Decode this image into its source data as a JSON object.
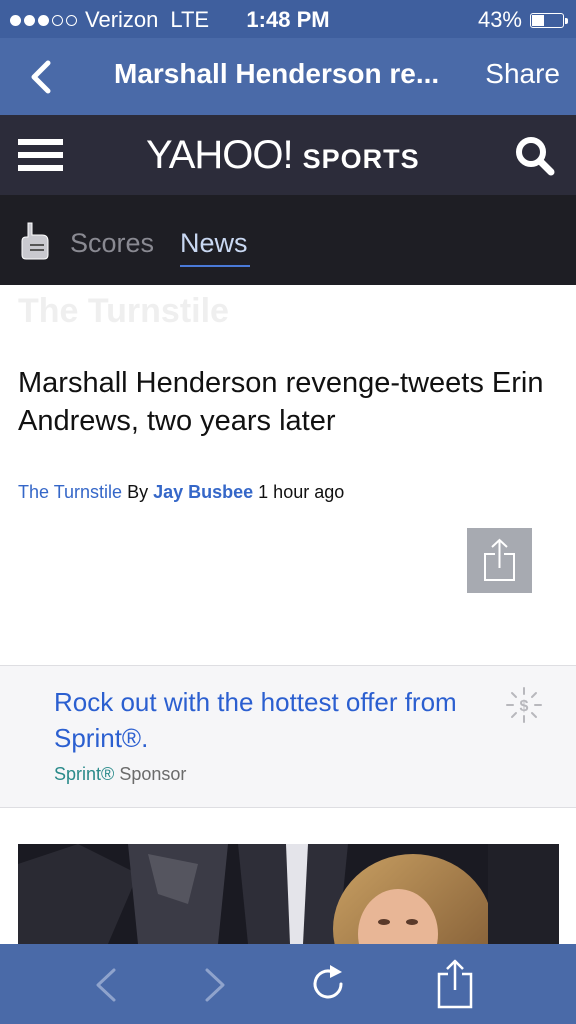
{
  "status_bar": {
    "carrier": "Verizon",
    "network": "LTE",
    "time": "1:48 PM",
    "battery": "43%",
    "signal_bars_filled": 3,
    "signal_bars_total": 5,
    "battery_level": 0.43
  },
  "nav_bar": {
    "title": "Marshall Henderson re...",
    "share_label": "Share"
  },
  "yahoo_header": {
    "logo_text": "YAHOO!",
    "sports_text": "SPORTS"
  },
  "tabs": {
    "scores": "Scores",
    "news": "News",
    "active": "News"
  },
  "article": {
    "section": "The Turnstile",
    "headline": "Marshall Henderson revenge-tweets Erin Andrews, two years later",
    "source": "The Turnstile",
    "by": "By",
    "author": "Jay Busbee",
    "time_ago": "1 hour ago"
  },
  "ad": {
    "text": "Rock out with the hottest offer from Sprint®.",
    "sponsor_name": "Sprint®",
    "sponsor_label": "Sponsor"
  },
  "colors": {
    "nav_blue": "#4a6aa8",
    "link_blue": "#3567c8",
    "header_dark": "#2c2c3a",
    "tab_dark": "#1e1e24"
  },
  "toolbar": {
    "icons": [
      "back-icon",
      "forward-icon",
      "reload-icon",
      "share-icon"
    ]
  }
}
